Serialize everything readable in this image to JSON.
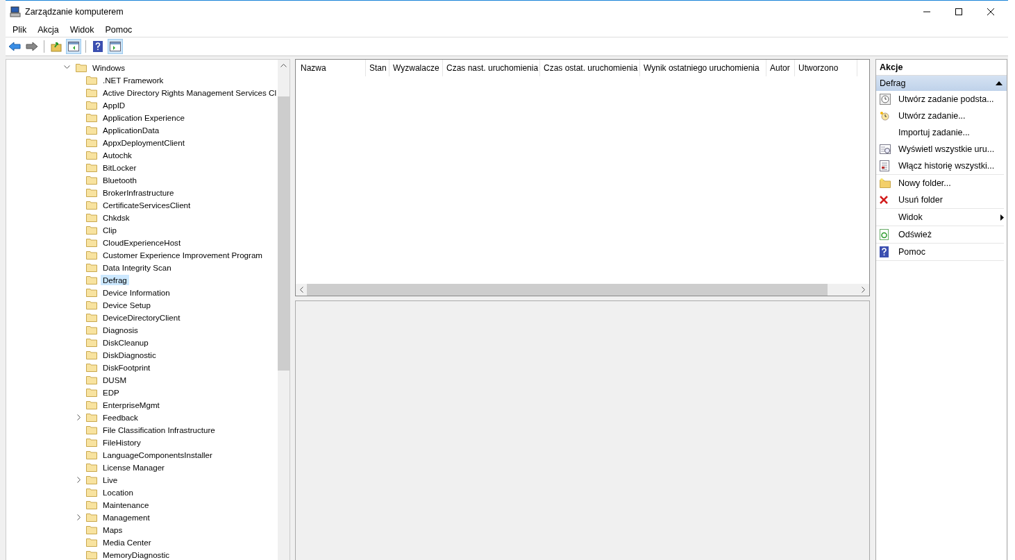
{
  "window": {
    "title": "Zarządzanie komputerem"
  },
  "menu": [
    "Plik",
    "Akcja",
    "Widok",
    "Pomoc"
  ],
  "toolbar": [
    [
      {
        "kind": "back",
        "selected": false
      },
      {
        "kind": "forward",
        "selected": false
      }
    ],
    [
      {
        "kind": "up",
        "selected": false
      },
      {
        "kind": "tree",
        "selected": true
      }
    ],
    [
      {
        "kind": "help",
        "selected": false
      },
      {
        "kind": "pane",
        "selected": true
      }
    ]
  ],
  "tree": {
    "label": "Windows",
    "expanded": true,
    "children": [
      {
        "label": ".NET Framework",
        "expandable": false,
        "selected": false
      },
      {
        "label": "Active Directory Rights Management Services Cl",
        "expandable": false,
        "selected": false
      },
      {
        "label": "AppID",
        "expandable": false,
        "selected": false
      },
      {
        "label": "Application Experience",
        "expandable": false,
        "selected": false
      },
      {
        "label": "ApplicationData",
        "expandable": false,
        "selected": false
      },
      {
        "label": "AppxDeploymentClient",
        "expandable": false,
        "selected": false
      },
      {
        "label": "Autochk",
        "expandable": false,
        "selected": false
      },
      {
        "label": "BitLocker",
        "expandable": false,
        "selected": false
      },
      {
        "label": "Bluetooth",
        "expandable": false,
        "selected": false
      },
      {
        "label": "BrokerInfrastructure",
        "expandable": false,
        "selected": false
      },
      {
        "label": "CertificateServicesClient",
        "expandable": false,
        "selected": false
      },
      {
        "label": "Chkdsk",
        "expandable": false,
        "selected": false
      },
      {
        "label": "Clip",
        "expandable": false,
        "selected": false
      },
      {
        "label": "CloudExperienceHost",
        "expandable": false,
        "selected": false
      },
      {
        "label": "Customer Experience Improvement Program",
        "expandable": false,
        "selected": false
      },
      {
        "label": "Data Integrity Scan",
        "expandable": false,
        "selected": false
      },
      {
        "label": "Defrag",
        "expandable": false,
        "selected": true
      },
      {
        "label": "Device Information",
        "expandable": false,
        "selected": false
      },
      {
        "label": "Device Setup",
        "expandable": false,
        "selected": false
      },
      {
        "label": "DeviceDirectoryClient",
        "expandable": false,
        "selected": false
      },
      {
        "label": "Diagnosis",
        "expandable": false,
        "selected": false
      },
      {
        "label": "DiskCleanup",
        "expandable": false,
        "selected": false
      },
      {
        "label": "DiskDiagnostic",
        "expandable": false,
        "selected": false
      },
      {
        "label": "DiskFootprint",
        "expandable": false,
        "selected": false
      },
      {
        "label": "DUSM",
        "expandable": false,
        "selected": false
      },
      {
        "label": "EDP",
        "expandable": false,
        "selected": false
      },
      {
        "label": "EnterpriseMgmt",
        "expandable": false,
        "selected": false
      },
      {
        "label": "Feedback",
        "expandable": true,
        "selected": false
      },
      {
        "label": "File Classification Infrastructure",
        "expandable": false,
        "selected": false
      },
      {
        "label": "FileHistory",
        "expandable": false,
        "selected": false
      },
      {
        "label": "LanguageComponentsInstaller",
        "expandable": false,
        "selected": false
      },
      {
        "label": "License Manager",
        "expandable": false,
        "selected": false
      },
      {
        "label": "Live",
        "expandable": true,
        "selected": false
      },
      {
        "label": "Location",
        "expandable": false,
        "selected": false
      },
      {
        "label": "Maintenance",
        "expandable": false,
        "selected": false
      },
      {
        "label": "Management",
        "expandable": true,
        "selected": false
      },
      {
        "label": "Maps",
        "expandable": false,
        "selected": false
      },
      {
        "label": "Media Center",
        "expandable": false,
        "selected": false
      },
      {
        "label": "MemoryDiagnostic",
        "expandable": false,
        "selected": false
      }
    ]
  },
  "table": {
    "columns": [
      "Nazwa",
      "Stan",
      "Wyzwalacze",
      "Czas nast. uruchomienia",
      "Czas ostat. uruchomienia",
      "Wynik ostatniego uruchomienia",
      "Autor",
      "Utworzono"
    ]
  },
  "actions": {
    "title": "Akcje",
    "section": {
      "label": "Defrag",
      "expanded": true
    },
    "groups": [
      [
        {
          "label": "Utwórz zadanie podsta...",
          "kind": "clock"
        },
        {
          "label": "Utwórz zadanie...",
          "kind": "task"
        },
        {
          "label": "Importuj zadanie...",
          "kind": "none"
        },
        {
          "label": "Wyświetl wszystkie uru...",
          "kind": "list"
        },
        {
          "label": "Włącz historię wszystki...",
          "kind": "history"
        }
      ],
      [
        {
          "label": "Nowy folder...",
          "kind": "folder"
        },
        {
          "label": "Usuń folder",
          "kind": "delete"
        }
      ],
      [
        {
          "label": "Widok",
          "kind": "submenu"
        }
      ],
      [
        {
          "label": "Odśwież",
          "kind": "refresh"
        }
      ],
      [
        {
          "label": "Pomoc",
          "kind": "help"
        }
      ]
    ]
  }
}
